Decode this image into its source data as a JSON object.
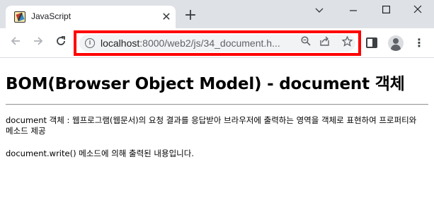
{
  "browser": {
    "tab": {
      "title": "JavaScript",
      "close_glyph": "✕",
      "favicon": "javascript-favicon-icon"
    },
    "new_tab_glyph": "+",
    "window_controls": {
      "minimize": "minimize-icon",
      "maximize": "maximize-icon",
      "close": "close-icon",
      "chevron": "chevron-down-icon"
    },
    "toolbar": {
      "back": "back-arrow-icon",
      "forward": "forward-arrow-icon",
      "reload": "reload-icon",
      "url_host": "localhost",
      "url_path": ":8000/web2/js/34_document.h...",
      "omnibox_highlight_color": "#ff0000",
      "omnibox_icons": [
        "zoom-icon",
        "share-icon",
        "bookmark-star-icon"
      ]
    }
  },
  "page": {
    "title": "BOM(Browser Object Model) - document 객체",
    "description": "document 객체 : 웹프로그램(웹문서)의 요청 결과를 응답받아 브라우저에 출력하는 영역을 객체로 표현하여 프로퍼티와 메소드 제공",
    "written_text": "document.write() 메소드에 의해 출력된 내용입니다."
  }
}
